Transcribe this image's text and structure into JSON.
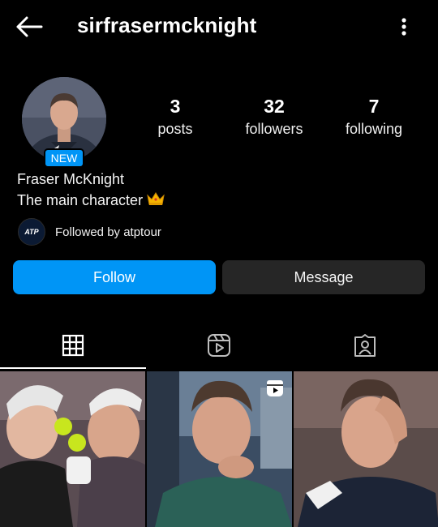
{
  "header": {
    "username": "sirfrasermcknight",
    "back_icon": "arrow-left-icon",
    "menu_icon": "more-vertical-icon"
  },
  "profile": {
    "badge": "NEW",
    "name": "Fraser McKnight",
    "bio": "The main character",
    "bio_emoji": "crown-emoji"
  },
  "stats": [
    {
      "value": "3",
      "label": "posts"
    },
    {
      "value": "32",
      "label": "followers"
    },
    {
      "value": "7",
      "label": "following"
    }
  ],
  "followed_by": {
    "logo_text": "ATP",
    "text": "Followed by atptour"
  },
  "actions": {
    "follow": "Follow",
    "message": "Message"
  },
  "tabs": [
    {
      "name": "posts-grid",
      "icon": "grid-icon",
      "active": true
    },
    {
      "name": "reels",
      "icon": "reels-icon",
      "active": false
    },
    {
      "name": "tagged",
      "icon": "tagged-person-icon",
      "active": false
    }
  ],
  "colors": {
    "background": "#000000",
    "accent": "#0095f6",
    "secondary_button": "#262626"
  }
}
